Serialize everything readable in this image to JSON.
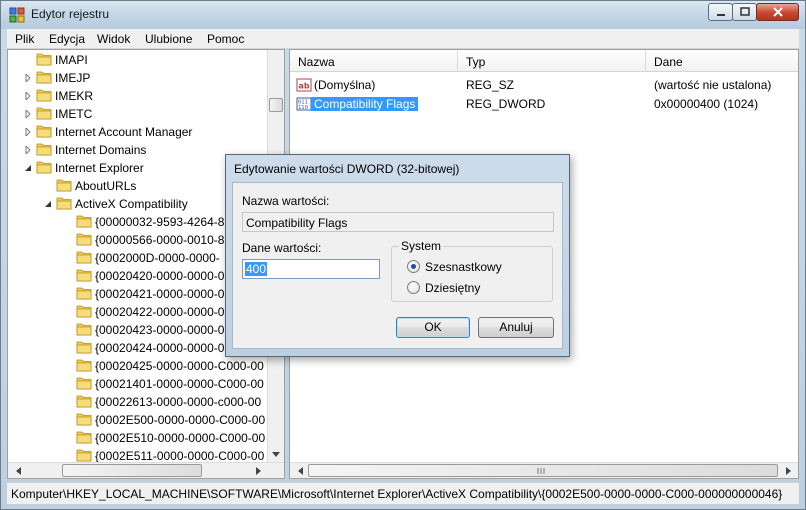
{
  "window": {
    "title": "Edytor rejestru"
  },
  "menu": [
    "Plik",
    "Edycja",
    "Widok",
    "Ulubione",
    "Pomoc"
  ],
  "tree": {
    "items": [
      {
        "label": "IMAPI",
        "level": 1,
        "expand": "none"
      },
      {
        "label": "IMEJP",
        "level": 1,
        "expand": "collapsed"
      },
      {
        "label": "IMEKR",
        "level": 1,
        "expand": "collapsed"
      },
      {
        "label": "IMETC",
        "level": 1,
        "expand": "collapsed"
      },
      {
        "label": "Internet Account Manager",
        "level": 1,
        "expand": "collapsed"
      },
      {
        "label": "Internet Domains",
        "level": 1,
        "expand": "collapsed"
      },
      {
        "label": "Internet Explorer",
        "level": 1,
        "expand": "expanded"
      },
      {
        "label": "AboutURLs",
        "level": 2,
        "expand": "none"
      },
      {
        "label": "ActiveX Compatibility",
        "level": 2,
        "expand": "expanded"
      },
      {
        "label": "{00000032-9593-4264-8",
        "level": 3,
        "expand": "none"
      },
      {
        "label": "{00000566-0000-0010-8",
        "level": 3,
        "expand": "none"
      },
      {
        "label": "{0002000D-0000-0000-",
        "level": 3,
        "expand": "none"
      },
      {
        "label": "{00020420-0000-0000-0",
        "level": 3,
        "expand": "none"
      },
      {
        "label": "{00020421-0000-0000-0",
        "level": 3,
        "expand": "none"
      },
      {
        "label": "{00020422-0000-0000-0",
        "level": 3,
        "expand": "none"
      },
      {
        "label": "{00020423-0000-0000-0",
        "level": 3,
        "expand": "none"
      },
      {
        "label": "{00020424-0000-0000-0",
        "level": 3,
        "expand": "none"
      },
      {
        "label": "{00020425-0000-0000-C000-00",
        "level": 3,
        "expand": "none"
      },
      {
        "label": "{00021401-0000-0000-C000-00",
        "level": 3,
        "expand": "none"
      },
      {
        "label": "{00022613-0000-0000-c000-00",
        "level": 3,
        "expand": "none"
      },
      {
        "label": "{0002E500-0000-0000-C000-00",
        "level": 3,
        "expand": "none"
      },
      {
        "label": "{0002E510-0000-0000-C000-00",
        "level": 3,
        "expand": "none"
      },
      {
        "label": "{0002E511-0000-0000-C000-00",
        "level": 3,
        "expand": "none"
      }
    ]
  },
  "list": {
    "columns": [
      "Nazwa",
      "Typ",
      "Dane"
    ],
    "rows": [
      {
        "icon": "string-value-icon",
        "name": "(Domyślna)",
        "type": "REG_SZ",
        "data": "(wartość nie ustalona)",
        "selected": false
      },
      {
        "icon": "binary-value-icon",
        "name": "Compatibility Flags",
        "type": "REG_DWORD",
        "data": "0x00000400 (1024)",
        "selected": true
      }
    ]
  },
  "status": {
    "path": "Komputer\\HKEY_LOCAL_MACHINE\\SOFTWARE\\Microsoft\\Internet Explorer\\ActiveX Compatibility\\{0002E500-0000-0000-C000-000000000046}"
  },
  "dialog": {
    "title": "Edytowanie wartości DWORD (32-bitowej)",
    "name_label": "Nazwa wartości:",
    "name_value": "Compatibility Flags",
    "data_label": "Dane wartości:",
    "data_value": "400",
    "system_label": "System",
    "radio_hex": "Szesnastkowy",
    "radio_dec": "Dziesiętny",
    "selected_base": "hex",
    "ok": "OK",
    "cancel": "Anuluj"
  },
  "colors": {
    "selection": "#3399ff",
    "folder": "#f2c94c",
    "title_gradient_top": "#dbe7f1"
  }
}
